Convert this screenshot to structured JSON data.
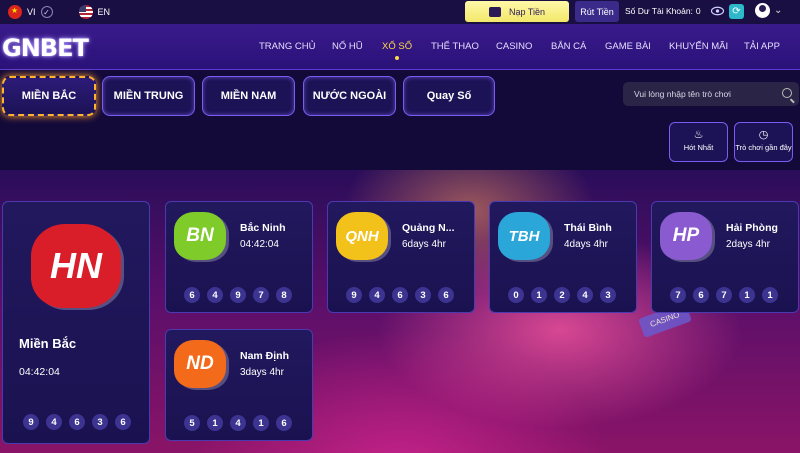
{
  "topbar": {
    "lang_vi": "VI",
    "lang_en": "EN",
    "deposit_label": "Nạp Tiền",
    "withdraw_label": "Rút Tiền",
    "balance_label": "Số Dư Tài Khoản:",
    "balance_value": "0",
    "icons": [
      "vn-flag-icon",
      "check-icon",
      "us-flag-icon",
      "wallet-icon",
      "eye-icon",
      "refresh-icon",
      "user-icon",
      "chevron-down-icon"
    ]
  },
  "nav": {
    "logo": "GNBET",
    "items": [
      "TRANG CHỦ",
      "NỔ HŨ",
      "XỔ SỐ",
      "THỂ THAO",
      "CASINO",
      "BẮN CÁ",
      "GAME BÀI",
      "KHUYẾN MÃI",
      "TẢI APP"
    ],
    "active_index": 2
  },
  "filters": {
    "tabs": [
      "MIỀN BẮC",
      "MIỀN TRUNG",
      "MIỀN NAM",
      "NƯỚC NGOÀI",
      "Quay Số"
    ],
    "active_index": 0,
    "search_placeholder": "Vui lòng nhập tên trò chơi",
    "hot_label": "Hót Nhất",
    "recent_label": "Trò chơi gần đây"
  },
  "games": [
    {
      "code": "HN",
      "name": "Miền Bắc",
      "time": "04:42:04",
      "numbers": [
        "9",
        "4",
        "6",
        "3",
        "6"
      ],
      "color": "#d91e2a"
    },
    {
      "code": "BN",
      "name": "Bắc Ninh",
      "time": "04:42:04",
      "numbers": [
        "6",
        "4",
        "9",
        "7",
        "8"
      ],
      "color": "#7ecb2a"
    },
    {
      "code": "QNH",
      "name": "Quảng N...",
      "time": "6days 4hr",
      "numbers": [
        "9",
        "4",
        "6",
        "3",
        "6"
      ],
      "color": "#f2c21a"
    },
    {
      "code": "TBH",
      "name": "Thái Bình",
      "time": "4days 4hr",
      "numbers": [
        "0",
        "1",
        "2",
        "4",
        "3"
      ],
      "color": "#2aa6d9"
    },
    {
      "code": "HP",
      "name": "Hải Phòng",
      "time": "2days 4hr",
      "numbers": [
        "7",
        "6",
        "7",
        "1",
        "1"
      ],
      "color": "#8a5ad0"
    },
    {
      "code": "ND",
      "name": "Nam Định",
      "time": "3days 4hr",
      "numbers": [
        "5",
        "1",
        "4",
        "1",
        "6"
      ],
      "color": "#f26a1a"
    }
  ]
}
